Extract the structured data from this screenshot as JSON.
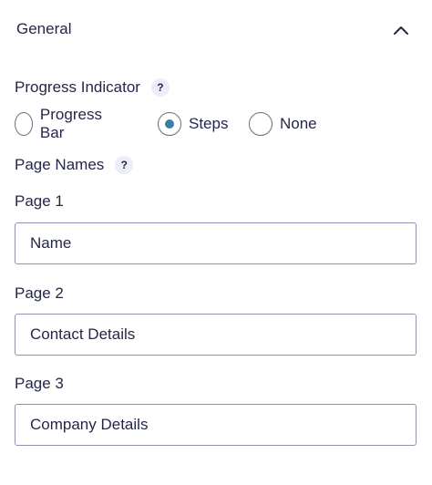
{
  "section": {
    "title": "General",
    "collapse_icon": "chevron-up-icon"
  },
  "progress_indicator": {
    "label": "Progress Indicator",
    "help": "?",
    "options": [
      {
        "label": "Progress Bar",
        "selected": false
      },
      {
        "label": "Steps",
        "selected": true
      },
      {
        "label": "None",
        "selected": false
      }
    ]
  },
  "page_names": {
    "label": "Page Names",
    "help": "?",
    "pages": [
      {
        "label": "Page 1",
        "value": "Name"
      },
      {
        "label": "Page 2",
        "value": "Contact Details"
      },
      {
        "label": "Page 3",
        "value": "Company Details"
      }
    ]
  },
  "colors": {
    "text": "#242748",
    "radio_selected": "#3e7da6",
    "input_border": "#9092b2",
    "help_bg": "#ecedf8"
  }
}
